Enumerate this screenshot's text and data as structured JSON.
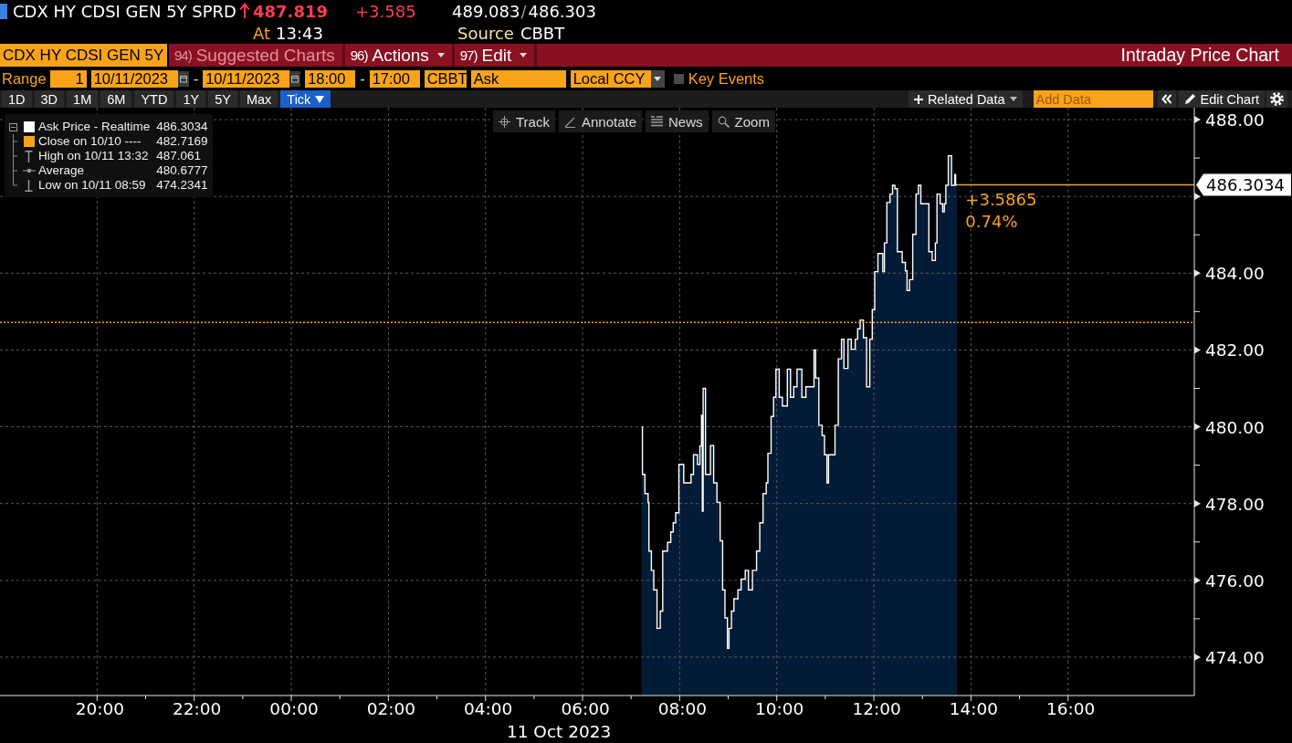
{
  "header": {
    "security": "CDX HY CDSI GEN 5Y SPRD",
    "last": "487.819",
    "change": "+3.585",
    "bid": "489.083",
    "separator": "/",
    "ask": "486.303",
    "time_label": "At",
    "time": "13:43",
    "source_label": "Source",
    "source": "CBBT"
  },
  "toolbar": {
    "security_field": "CDX HY CDSI GEN 5Y",
    "menus": [
      {
        "number": "94)",
        "label": "Suggested Charts",
        "disabled": true,
        "dropdown": false
      },
      {
        "number": "96)",
        "label": "Actions",
        "disabled": false,
        "dropdown": true
      },
      {
        "number": "97)",
        "label": "Edit",
        "disabled": false,
        "dropdown": true
      }
    ],
    "title": "Intraday Price Chart"
  },
  "range_bar": {
    "label": "Range",
    "fields": [
      {
        "kind": "number",
        "value": "1"
      },
      {
        "kind": "date",
        "value": "10/11/2023"
      },
      {
        "kind": "separator",
        "value": "-"
      },
      {
        "kind": "date",
        "value": "10/11/2023"
      },
      {
        "kind": "time",
        "value": "18:00"
      },
      {
        "kind": "separator",
        "value": "-"
      },
      {
        "kind": "time",
        "value": "17:00"
      },
      {
        "kind": "text",
        "value": "CBBT"
      },
      {
        "kind": "text",
        "value": "Ask"
      },
      {
        "kind": "dropdown",
        "value": "Local CCY"
      }
    ],
    "key_events": {
      "label": "Key Events",
      "checked": false
    }
  },
  "period_tabs": [
    {
      "label": "1D",
      "selected": false,
      "dropdown": false
    },
    {
      "label": "3D",
      "selected": false,
      "dropdown": false
    },
    {
      "label": "1M",
      "selected": false,
      "dropdown": false
    },
    {
      "label": "6M",
      "selected": false,
      "dropdown": false
    },
    {
      "label": "YTD",
      "selected": false,
      "dropdown": false
    },
    {
      "label": "1Y",
      "selected": false,
      "dropdown": false
    },
    {
      "label": "5Y",
      "selected": false,
      "dropdown": false
    },
    {
      "label": "Max",
      "selected": false,
      "dropdown": false
    },
    {
      "label": "Tick",
      "selected": true,
      "dropdown": true
    }
  ],
  "chart_tools": {
    "related_data": "Related Data",
    "add_data": {
      "placeholder": "Add Data"
    },
    "edit_chart": "Edit Chart"
  },
  "chart": {
    "tools": [
      {
        "kind": "track",
        "label": "Track"
      },
      {
        "kind": "annotate",
        "label": "Annotate"
      },
      {
        "kind": "news",
        "label": "News"
      },
      {
        "kind": "zoom",
        "label": "Zoom"
      }
    ],
    "legend_items": [
      {
        "kind": "swatch",
        "label": "Ask Price - Realtime",
        "value": "486.3034",
        "color": "#ffffff"
      },
      {
        "kind": "swatch",
        "label": "Close on 10/10 ----",
        "value": "482.7169",
        "color": "#f7a21b"
      },
      {
        "kind": "high",
        "label": "High on 10/11 13:32",
        "value": "487.061"
      },
      {
        "kind": "average",
        "label": "Average",
        "value": "480.6777"
      },
      {
        "kind": "low",
        "label": "Low on 10/11 08:59",
        "value": "474.2341"
      }
    ],
    "chart_data": {
      "type": "area",
      "xlabel": "11 Oct 2023",
      "grid": true,
      "x": [
        "2023-10-11T07:13",
        "2023-10-11T07:14",
        "2023-10-11T07:17",
        "2023-10-11T07:21",
        "2023-10-11T07:22",
        "2023-10-11T07:25",
        "2023-10-11T07:28",
        "2023-10-11T07:32",
        "2023-10-11T07:36",
        "2023-10-11T07:39",
        "2023-10-11T07:45",
        "2023-10-11T07:49",
        "2023-10-11T07:52",
        "2023-10-11T07:55",
        "2023-10-11T07:59",
        "2023-10-11T08:05",
        "2023-10-11T08:14",
        "2023-10-11T08:17",
        "2023-10-11T08:22",
        "2023-10-11T08:25",
        "2023-10-11T08:27",
        "2023-10-11T08:28",
        "2023-10-11T08:29",
        "2023-10-11T08:32",
        "2023-10-11T08:38",
        "2023-10-11T08:42",
        "2023-10-11T08:46",
        "2023-10-11T08:50",
        "2023-10-11T08:53",
        "2023-10-11T08:56",
        "2023-10-11T08:59",
        "2023-10-11T09:01",
        "2023-10-11T09:04",
        "2023-10-11T09:07",
        "2023-10-11T09:12",
        "2023-10-11T09:16",
        "2023-10-11T09:21",
        "2023-10-11T09:25",
        "2023-10-11T09:30",
        "2023-10-11T09:35",
        "2023-10-11T09:39",
        "2023-10-11T09:43",
        "2023-10-11T09:47",
        "2023-10-11T09:49",
        "2023-10-11T09:53",
        "2023-10-11T09:56",
        "2023-10-11T09:59",
        "2023-10-11T10:03",
        "2023-10-11T10:07",
        "2023-10-11T10:13",
        "2023-10-11T10:17",
        "2023-10-11T10:21",
        "2023-10-11T10:25",
        "2023-10-11T10:31",
        "2023-10-11T10:36",
        "2023-10-11T10:46",
        "2023-10-11T10:48",
        "2023-10-11T10:52",
        "2023-10-11T10:56",
        "2023-10-11T10:59",
        "2023-10-11T11:02",
        "2023-10-11T11:04",
        "2023-10-11T11:12",
        "2023-10-11T11:16",
        "2023-10-11T11:20",
        "2023-10-11T11:23",
        "2023-10-11T11:28",
        "2023-10-11T11:32",
        "2023-10-11T11:37",
        "2023-10-11T11:40",
        "2023-10-11T11:43",
        "2023-10-11T11:47",
        "2023-10-11T11:51",
        "2023-10-11T11:55",
        "2023-10-11T11:58",
        "2023-10-11T12:01",
        "2023-10-11T12:05",
        "2023-10-11T12:11",
        "2023-10-11T12:13",
        "2023-10-11T12:16",
        "2023-10-11T12:20",
        "2023-10-11T12:23",
        "2023-10-11T12:26",
        "2023-10-11T12:29",
        "2023-10-11T12:35",
        "2023-10-11T12:39",
        "2023-10-11T12:41",
        "2023-10-11T12:44",
        "2023-10-11T12:48",
        "2023-10-11T12:52",
        "2023-10-11T12:55",
        "2023-10-11T12:58",
        "2023-10-11T13:08",
        "2023-10-11T13:12",
        "2023-10-11T13:16",
        "2023-10-11T13:18",
        "2023-10-11T13:22",
        "2023-10-11T13:25",
        "2023-10-11T13:27",
        "2023-10-11T13:29",
        "2023-10-11T13:32",
        "2023-10-11T13:36",
        "2023-10-11T13:40",
        "2023-10-11T13:41",
        "2023-10-11T13:43"
      ],
      "series": [
        {
          "type": "area",
          "color": "#041b37",
          "values": [
            480.0,
            478.76,
            478.26,
            478.03,
            476.76,
            476.26,
            475.75,
            474.75,
            475.2,
            476.76,
            476.99,
            477.26,
            477.5,
            477.76,
            479.02,
            478.54,
            478.76,
            479.27,
            479.02,
            479.5,
            480.3,
            477.8,
            481.0,
            478.76,
            479.51,
            478.54,
            478.03,
            477.03,
            475.75,
            475.02,
            474.23,
            474.75,
            475.2,
            475.52,
            475.75,
            476.03,
            476.26,
            475.75,
            476.26,
            476.76,
            477.5,
            478.26,
            478.54,
            479.31,
            480.27,
            480.77,
            481.5,
            480.77,
            480.54,
            481.5,
            480.77,
            481.04,
            481.5,
            480.77,
            481.04,
            482.0,
            481.27,
            480.04,
            479.77,
            479.27,
            478.54,
            479.27,
            480.04,
            481.77,
            482.28,
            481.52,
            482.28,
            482.02,
            482.28,
            482.55,
            482.78,
            482.32,
            481.04,
            482.28,
            483.05,
            484.04,
            484.51,
            484.04,
            484.79,
            485.84,
            486.06,
            486.29,
            486.2,
            484.56,
            484.28,
            484.06,
            483.55,
            483.83,
            485.01,
            486.06,
            486.29,
            485.81,
            484.56,
            484.33,
            484.79,
            486.06,
            485.81,
            485.6,
            485.81,
            486.29,
            487.06,
            486.29,
            486.57,
            486.3,
            486.3
          ]
        },
        {
          "type": "step",
          "color": "#ffffff",
          "values": [
            480.0,
            478.76,
            478.26,
            478.03,
            476.76,
            476.26,
            475.75,
            474.75,
            475.2,
            476.76,
            476.99,
            477.26,
            477.5,
            477.76,
            479.02,
            478.54,
            478.76,
            479.27,
            479.02,
            479.5,
            480.3,
            477.8,
            481.0,
            478.76,
            479.51,
            478.54,
            478.03,
            477.03,
            475.75,
            475.02,
            474.23,
            474.75,
            475.2,
            475.52,
            475.75,
            476.03,
            476.26,
            475.75,
            476.26,
            476.76,
            477.5,
            478.26,
            478.54,
            479.31,
            480.27,
            480.77,
            481.5,
            480.77,
            480.54,
            481.5,
            480.77,
            481.04,
            481.5,
            480.77,
            481.04,
            482.0,
            481.27,
            480.04,
            479.77,
            479.27,
            478.54,
            479.27,
            480.04,
            481.77,
            482.28,
            481.52,
            482.28,
            482.02,
            482.28,
            482.55,
            482.78,
            482.32,
            481.04,
            482.28,
            483.05,
            484.04,
            484.51,
            484.04,
            484.79,
            485.84,
            486.06,
            486.29,
            486.2,
            484.56,
            484.28,
            484.06,
            483.55,
            483.83,
            485.01,
            486.06,
            486.29,
            485.81,
            484.56,
            484.33,
            484.79,
            486.06,
            485.81,
            485.6,
            485.81,
            486.29,
            487.06,
            486.29,
            486.57,
            486.3,
            486.3
          ]
        }
      ],
      "xlim": [
        "2023-10-10T18:00",
        "2023-10-11T18:36"
      ],
      "ylim": [
        473,
        488.31
      ],
      "xticks": [
        {
          "value": "2023-10-10T20:00",
          "label": "20:00"
        },
        {
          "value": "2023-10-10T22:00",
          "label": "22:00"
        },
        {
          "value": "2023-10-11T00:00",
          "label": "00:00"
        },
        {
          "value": "2023-10-11T02:00",
          "label": "02:00"
        },
        {
          "value": "2023-10-11T04:00",
          "label": "04:00"
        },
        {
          "value": "2023-10-11T06:00",
          "label": "06:00"
        },
        {
          "value": "2023-10-11T08:00",
          "label": "08:00"
        },
        {
          "value": "2023-10-11T10:00",
          "label": "10:00"
        },
        {
          "value": "2023-10-11T12:00",
          "label": "12:00"
        },
        {
          "value": "2023-10-11T14:00",
          "label": "14:00"
        },
        {
          "value": "2023-10-11T16:00",
          "label": "16:00"
        }
      ],
      "yticks": [
        {
          "value": 474,
          "label": "474.00"
        },
        {
          "value": 476,
          "label": "476.00"
        },
        {
          "value": 478,
          "label": "478.00"
        },
        {
          "value": 480,
          "label": "480.00"
        },
        {
          "value": 482,
          "label": "482.00"
        },
        {
          "value": 484,
          "label": "484.00"
        },
        {
          "value": 488,
          "label": "488.00"
        }
      ],
      "ref_lines": [
        {
          "axis": "y",
          "value": 482.7169,
          "color": "#f7a21b",
          "line_style": "dotted"
        },
        {
          "axis": "y",
          "value": 486.3034,
          "label": "486.3034",
          "color": "#f7a21b",
          "line_style": "solid"
        }
      ],
      "annotations": [
        "+3.5865",
        "0.74%"
      ]
    }
  }
}
